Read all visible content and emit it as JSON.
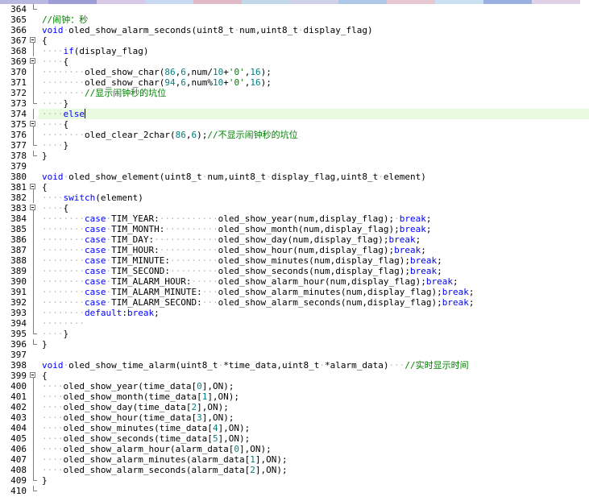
{
  "editor": {
    "tab_colors": [
      "#b8b8e0",
      "#9c9cd6",
      "#d8c8e8",
      "#c8d8f0",
      "#e0b8c8",
      "#c0d8e8",
      "#d0d0e8",
      "#b0c8e8",
      "#e8c8d0",
      "#c8e0f0",
      "#9ab0e0",
      "#e0d0e8"
    ],
    "gutter_bg": "#ffffff",
    "highlight_line": "#e8fbe1",
    "colors": {
      "keyword": "#0000ff",
      "comment": "#008000",
      "number": "#008080",
      "text": "#000000",
      "whitespace_marker": "#b9b9b9"
    },
    "lines": [
      {
        "n": "364",
        "fold": "end",
        "tokens": []
      },
      {
        "n": "365",
        "fold": "none",
        "tokens": [
          {
            "t": "//闹钟：秒",
            "c": "cm"
          }
        ]
      },
      {
        "n": "366",
        "fold": "none",
        "tokens": [
          {
            "t": "void",
            "c": "kw"
          },
          {
            "t": "·",
            "c": "ws"
          },
          {
            "t": "oled_show_alarm_seconds(uint8_t"
          },
          {
            "t": "·",
            "c": "ws"
          },
          {
            "t": "num,uint8_t"
          },
          {
            "t": "·",
            "c": "ws"
          },
          {
            "t": "display_flag)"
          }
        ]
      },
      {
        "n": "367",
        "fold": "start",
        "tokens": [
          {
            "t": "{"
          }
        ]
      },
      {
        "n": "368",
        "fold": "line",
        "tokens": [
          {
            "t": "····",
            "c": "ws"
          },
          {
            "t": "if",
            "c": "kw"
          },
          {
            "t": "(display_flag)"
          }
        ]
      },
      {
        "n": "369",
        "fold": "start",
        "tokens": [
          {
            "t": "····",
            "c": "ws"
          },
          {
            "t": "{"
          }
        ]
      },
      {
        "n": "370",
        "fold": "line",
        "tokens": [
          {
            "t": "········",
            "c": "ws"
          },
          {
            "t": "oled_show_char("
          },
          {
            "t": "86",
            "c": "num"
          },
          {
            "t": ","
          },
          {
            "t": "6",
            "c": "num"
          },
          {
            "t": ",num/"
          },
          {
            "t": "10",
            "c": "num"
          },
          {
            "t": "+"
          },
          {
            "t": "'0'",
            "c": "cm"
          },
          {
            "t": ","
          },
          {
            "t": "16",
            "c": "num"
          },
          {
            "t": ");"
          }
        ]
      },
      {
        "n": "371",
        "fold": "line",
        "tokens": [
          {
            "t": "········",
            "c": "ws"
          },
          {
            "t": "oled_show_char("
          },
          {
            "t": "94",
            "c": "num"
          },
          {
            "t": ","
          },
          {
            "t": "6",
            "c": "num"
          },
          {
            "t": ",num%"
          },
          {
            "t": "10",
            "c": "num"
          },
          {
            "t": "+"
          },
          {
            "t": "'0'",
            "c": "cm"
          },
          {
            "t": ","
          },
          {
            "t": "16",
            "c": "num"
          },
          {
            "t": ");"
          }
        ]
      },
      {
        "n": "372",
        "fold": "line",
        "tokens": [
          {
            "t": "········",
            "c": "ws"
          },
          {
            "t": "//显示闹钟秒的坑位",
            "c": "cm"
          }
        ]
      },
      {
        "n": "373",
        "fold": "end",
        "tokens": [
          {
            "t": "····",
            "c": "ws"
          },
          {
            "t": "}"
          }
        ]
      },
      {
        "n": "374",
        "fold": "line",
        "hl": true,
        "caret": true,
        "tokens": [
          {
            "t": "····",
            "c": "ws"
          },
          {
            "t": "else",
            "c": "kw"
          }
        ]
      },
      {
        "n": "375",
        "fold": "start",
        "tokens": [
          {
            "t": "····",
            "c": "ws"
          },
          {
            "t": "{"
          }
        ]
      },
      {
        "n": "376",
        "fold": "line",
        "tokens": [
          {
            "t": "········",
            "c": "ws"
          },
          {
            "t": "oled_clear_2char("
          },
          {
            "t": "86",
            "c": "num"
          },
          {
            "t": ","
          },
          {
            "t": "6",
            "c": "num"
          },
          {
            "t": ");"
          },
          {
            "t": "//不显示闹钟秒的坑位",
            "c": "cm"
          }
        ]
      },
      {
        "n": "377",
        "fold": "end",
        "tokens": [
          {
            "t": "····",
            "c": "ws"
          },
          {
            "t": "}"
          }
        ]
      },
      {
        "n": "378",
        "fold": "end",
        "tokens": [
          {
            "t": "}"
          }
        ]
      },
      {
        "n": "379",
        "fold": "none",
        "tokens": []
      },
      {
        "n": "380",
        "fold": "none",
        "tokens": [
          {
            "t": "void",
            "c": "kw"
          },
          {
            "t": "·",
            "c": "ws"
          },
          {
            "t": "oled_show_element(uint8_t"
          },
          {
            "t": "·",
            "c": "ws"
          },
          {
            "t": "num,uint8_t"
          },
          {
            "t": "·",
            "c": "ws"
          },
          {
            "t": "display_flag,uint8_t"
          },
          {
            "t": "·",
            "c": "ws"
          },
          {
            "t": "element)"
          }
        ]
      },
      {
        "n": "381",
        "fold": "start",
        "tokens": [
          {
            "t": "{"
          }
        ]
      },
      {
        "n": "382",
        "fold": "line",
        "tokens": [
          {
            "t": "····",
            "c": "ws"
          },
          {
            "t": "switch",
            "c": "kw"
          },
          {
            "t": "(element)"
          }
        ]
      },
      {
        "n": "383",
        "fold": "start",
        "tokens": [
          {
            "t": "····",
            "c": "ws"
          },
          {
            "t": "{"
          }
        ]
      },
      {
        "n": "384",
        "fold": "line",
        "tokens": [
          {
            "t": "········",
            "c": "ws"
          },
          {
            "t": "case",
            "c": "kw"
          },
          {
            "t": "·",
            "c": "ws"
          },
          {
            "t": "TIM_YEAR:"
          },
          {
            "t": "···········",
            "c": "ws"
          },
          {
            "t": "oled_show_year(num,display_flag);"
          },
          {
            "t": "·",
            "c": "ws"
          },
          {
            "t": "break",
            "c": "kw"
          },
          {
            "t": ";"
          }
        ]
      },
      {
        "n": "385",
        "fold": "line",
        "tokens": [
          {
            "t": "········",
            "c": "ws"
          },
          {
            "t": "case",
            "c": "kw"
          },
          {
            "t": "·",
            "c": "ws"
          },
          {
            "t": "TIM_MONTH:"
          },
          {
            "t": "··········",
            "c": "ws"
          },
          {
            "t": "oled_show_month(num,display_flag);"
          },
          {
            "t": "break",
            "c": "kw"
          },
          {
            "t": ";"
          }
        ]
      },
      {
        "n": "386",
        "fold": "line",
        "tokens": [
          {
            "t": "········",
            "c": "ws"
          },
          {
            "t": "case",
            "c": "kw"
          },
          {
            "t": "·",
            "c": "ws"
          },
          {
            "t": "TIM_DAY:"
          },
          {
            "t": "············",
            "c": "ws"
          },
          {
            "t": "oled_show_day(num,display_flag);"
          },
          {
            "t": "break",
            "c": "kw"
          },
          {
            "t": ";"
          }
        ]
      },
      {
        "n": "387",
        "fold": "line",
        "tokens": [
          {
            "t": "········",
            "c": "ws"
          },
          {
            "t": "case",
            "c": "kw"
          },
          {
            "t": "·",
            "c": "ws"
          },
          {
            "t": "TIM_HOUR:"
          },
          {
            "t": "···········",
            "c": "ws"
          },
          {
            "t": "oled_show_hour(num,display_flag);"
          },
          {
            "t": "break",
            "c": "kw"
          },
          {
            "t": ";"
          }
        ]
      },
      {
        "n": "388",
        "fold": "line",
        "tokens": [
          {
            "t": "········",
            "c": "ws"
          },
          {
            "t": "case",
            "c": "kw"
          },
          {
            "t": "·",
            "c": "ws"
          },
          {
            "t": "TIM_MINUTE:"
          },
          {
            "t": "·········",
            "c": "ws"
          },
          {
            "t": "oled_show_minutes(num,display_flag);"
          },
          {
            "t": "break",
            "c": "kw"
          },
          {
            "t": ";"
          }
        ]
      },
      {
        "n": "389",
        "fold": "line",
        "tokens": [
          {
            "t": "········",
            "c": "ws"
          },
          {
            "t": "case",
            "c": "kw"
          },
          {
            "t": "·",
            "c": "ws"
          },
          {
            "t": "TIM_SECOND:"
          },
          {
            "t": "·········",
            "c": "ws"
          },
          {
            "t": "oled_show_seconds(num,display_flag);"
          },
          {
            "t": "break",
            "c": "kw"
          },
          {
            "t": ";"
          }
        ]
      },
      {
        "n": "390",
        "fold": "line",
        "tokens": [
          {
            "t": "········",
            "c": "ws"
          },
          {
            "t": "case",
            "c": "kw"
          },
          {
            "t": "·",
            "c": "ws"
          },
          {
            "t": "TIM_ALARM_HOUR:"
          },
          {
            "t": "·····",
            "c": "ws"
          },
          {
            "t": "oled_show_alarm_hour(num,display_flag);"
          },
          {
            "t": "break",
            "c": "kw"
          },
          {
            "t": ";"
          }
        ]
      },
      {
        "n": "391",
        "fold": "line",
        "tokens": [
          {
            "t": "········",
            "c": "ws"
          },
          {
            "t": "case",
            "c": "kw"
          },
          {
            "t": "·",
            "c": "ws"
          },
          {
            "t": "TIM_ALARM_MINUTE:"
          },
          {
            "t": "···",
            "c": "ws"
          },
          {
            "t": "oled_show_alarm_minutes(num,display_flag);"
          },
          {
            "t": "break",
            "c": "kw"
          },
          {
            "t": ";"
          }
        ]
      },
      {
        "n": "392",
        "fold": "line",
        "tokens": [
          {
            "t": "········",
            "c": "ws"
          },
          {
            "t": "case",
            "c": "kw"
          },
          {
            "t": "·",
            "c": "ws"
          },
          {
            "t": "TIM_ALARM_SECOND:"
          },
          {
            "t": "···",
            "c": "ws"
          },
          {
            "t": "oled_show_alarm_seconds(num,display_flag);"
          },
          {
            "t": "break",
            "c": "kw"
          },
          {
            "t": ";"
          }
        ]
      },
      {
        "n": "393",
        "fold": "line",
        "tokens": [
          {
            "t": "········",
            "c": "ws"
          },
          {
            "t": "default",
            "c": "kw"
          },
          {
            "t": ":"
          },
          {
            "t": "break",
            "c": "kw"
          },
          {
            "t": ";"
          }
        ]
      },
      {
        "n": "394",
        "fold": "line",
        "tokens": [
          {
            "t": "········",
            "c": "ws"
          }
        ]
      },
      {
        "n": "395",
        "fold": "end",
        "tokens": [
          {
            "t": "····",
            "c": "ws"
          },
          {
            "t": "}"
          }
        ]
      },
      {
        "n": "396",
        "fold": "end",
        "tokens": [
          {
            "t": "}"
          }
        ]
      },
      {
        "n": "397",
        "fold": "none",
        "tokens": []
      },
      {
        "n": "398",
        "fold": "none",
        "tokens": [
          {
            "t": "void",
            "c": "kw"
          },
          {
            "t": "·",
            "c": "ws"
          },
          {
            "t": "oled_show_time_alarm(uint8_t"
          },
          {
            "t": "·",
            "c": "ws"
          },
          {
            "t": "*time_data,uint8_t"
          },
          {
            "t": "·",
            "c": "ws"
          },
          {
            "t": "*alarm_data)"
          },
          {
            "t": "···",
            "c": "ws"
          },
          {
            "t": "//实时显示时间",
            "c": "cm"
          }
        ]
      },
      {
        "n": "399",
        "fold": "start",
        "tokens": [
          {
            "t": "{"
          }
        ]
      },
      {
        "n": "400",
        "fold": "line",
        "tokens": [
          {
            "t": "····",
            "c": "ws"
          },
          {
            "t": "oled_show_year(time_data["
          },
          {
            "t": "0",
            "c": "num"
          },
          {
            "t": "],ON);"
          }
        ]
      },
      {
        "n": "401",
        "fold": "line",
        "tokens": [
          {
            "t": "····",
            "c": "ws"
          },
          {
            "t": "oled_show_month(time_data["
          },
          {
            "t": "1",
            "c": "num"
          },
          {
            "t": "],ON);"
          }
        ]
      },
      {
        "n": "402",
        "fold": "line",
        "tokens": [
          {
            "t": "····",
            "c": "ws"
          },
          {
            "t": "oled_show_day(time_data["
          },
          {
            "t": "2",
            "c": "num"
          },
          {
            "t": "],ON);"
          }
        ]
      },
      {
        "n": "403",
        "fold": "line",
        "tokens": [
          {
            "t": "····",
            "c": "ws"
          },
          {
            "t": "oled_show_hour(time_data["
          },
          {
            "t": "3",
            "c": "num"
          },
          {
            "t": "],ON);"
          }
        ]
      },
      {
        "n": "404",
        "fold": "line",
        "tokens": [
          {
            "t": "····",
            "c": "ws"
          },
          {
            "t": "oled_show_minutes(time_data["
          },
          {
            "t": "4",
            "c": "num"
          },
          {
            "t": "],ON);"
          }
        ]
      },
      {
        "n": "405",
        "fold": "line",
        "tokens": [
          {
            "t": "····",
            "c": "ws"
          },
          {
            "t": "oled_show_seconds(time_data["
          },
          {
            "t": "5",
            "c": "num"
          },
          {
            "t": "],ON);"
          }
        ]
      },
      {
        "n": "406",
        "fold": "line",
        "tokens": [
          {
            "t": "····",
            "c": "ws"
          },
          {
            "t": "oled_show_alarm_hour(alarm_data["
          },
          {
            "t": "0",
            "c": "num"
          },
          {
            "t": "],ON);"
          }
        ]
      },
      {
        "n": "407",
        "fold": "line",
        "tokens": [
          {
            "t": "····",
            "c": "ws"
          },
          {
            "t": "oled_show_alarm_minutes(alarm_data["
          },
          {
            "t": "1",
            "c": "num"
          },
          {
            "t": "],ON);"
          }
        ]
      },
      {
        "n": "408",
        "fold": "line",
        "tokens": [
          {
            "t": "····",
            "c": "ws"
          },
          {
            "t": "oled_show_alarm_seconds(alarm_data["
          },
          {
            "t": "2",
            "c": "num"
          },
          {
            "t": "],ON);"
          }
        ]
      },
      {
        "n": "409",
        "fold": "end",
        "tokens": [
          {
            "t": "}"
          }
        ]
      },
      {
        "n": "410",
        "fold": "end",
        "tokens": []
      }
    ]
  }
}
